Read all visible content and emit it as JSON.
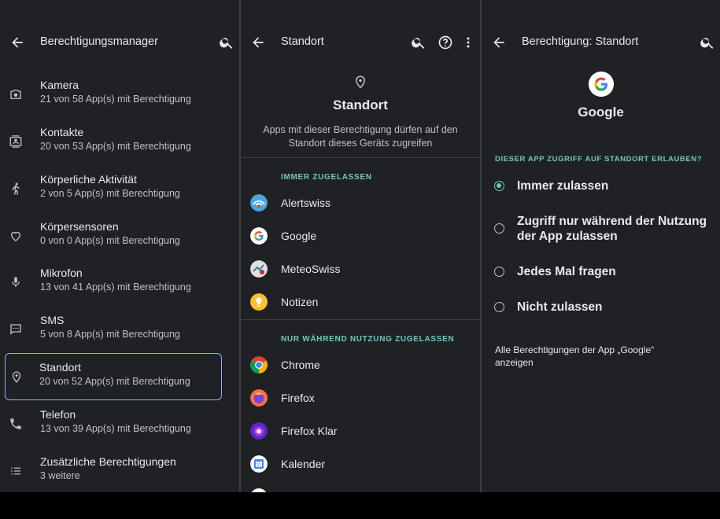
{
  "colors": {
    "background": "#202124",
    "accent": "#6ec9bd",
    "selection": "#8ab4f8"
  },
  "panel1": {
    "title": "Berechtigungsmanager",
    "items": [
      {
        "title": "Kamera",
        "subtitle": "21 von 58 App(s) mit Berechtigung",
        "icon": "camera-icon"
      },
      {
        "title": "Kontakte",
        "subtitle": "20 von 53 App(s) mit Berechtigung",
        "icon": "contacts-icon"
      },
      {
        "title": "Körperliche Aktivität",
        "subtitle": "2 von 5 App(s) mit Berechtigung",
        "icon": "walking-icon"
      },
      {
        "title": "Körpersensoren",
        "subtitle": "0 von 0 App(s) mit Berechtigung",
        "icon": "heart-icon"
      },
      {
        "title": "Mikrofon",
        "subtitle": "13 von 41 App(s) mit Berechtigung",
        "icon": "microphone-icon"
      },
      {
        "title": "SMS",
        "subtitle": "5 von 8 App(s) mit Berechtigung",
        "icon": "sms-icon"
      },
      {
        "title": "Standort",
        "subtitle": "20 von 52 App(s) mit Berechtigung",
        "icon": "location-icon",
        "selected": true
      },
      {
        "title": "Telefon",
        "subtitle": "13 von 39 App(s) mit Berechtigung",
        "icon": "phone-icon"
      },
      {
        "title": "Zusätzliche Berechtigungen",
        "subtitle": "3 weitere",
        "icon": "list-icon"
      }
    ]
  },
  "panel2": {
    "title": "Standort",
    "heading": "Standort",
    "description": "Apps mit dieser Berechtigung dürfen auf den Standort dieses Geräts zugreifen",
    "section_always": "IMMER ZUGELASSEN",
    "apps_always": [
      {
        "name": "Alertswiss",
        "icon": "alertswiss-icon"
      },
      {
        "name": "Google",
        "icon": "google-icon"
      },
      {
        "name": "MeteoSwiss",
        "icon": "meteoswiss-icon"
      },
      {
        "name": "Notizen",
        "icon": "notes-icon"
      }
    ],
    "section_while_using": "NUR WÄHREND NUTZUNG ZUGELASSEN",
    "apps_while_using": [
      {
        "name": "Chrome",
        "icon": "chrome-icon"
      },
      {
        "name": "Firefox",
        "icon": "firefox-icon"
      },
      {
        "name": "Firefox Klar",
        "icon": "firefox-focus-icon"
      },
      {
        "name": "Kalender",
        "icon": "calendar-icon"
      }
    ]
  },
  "panel3": {
    "title": "Berechtigung: Standort",
    "app_name": "Google",
    "section": "DIESER APP ZUGRIFF AUF STANDORT ERLAUBEN?",
    "options": [
      {
        "label": "Immer zulassen",
        "checked": true
      },
      {
        "label": "Zugriff nur während der Nutzung der App zulassen",
        "checked": false
      },
      {
        "label": "Jedes Mal fragen",
        "checked": false
      },
      {
        "label": "Nicht zulassen",
        "checked": false
      }
    ],
    "all_permissions_link": "Alle Berechtigungen der App „Google“ anzeigen"
  }
}
